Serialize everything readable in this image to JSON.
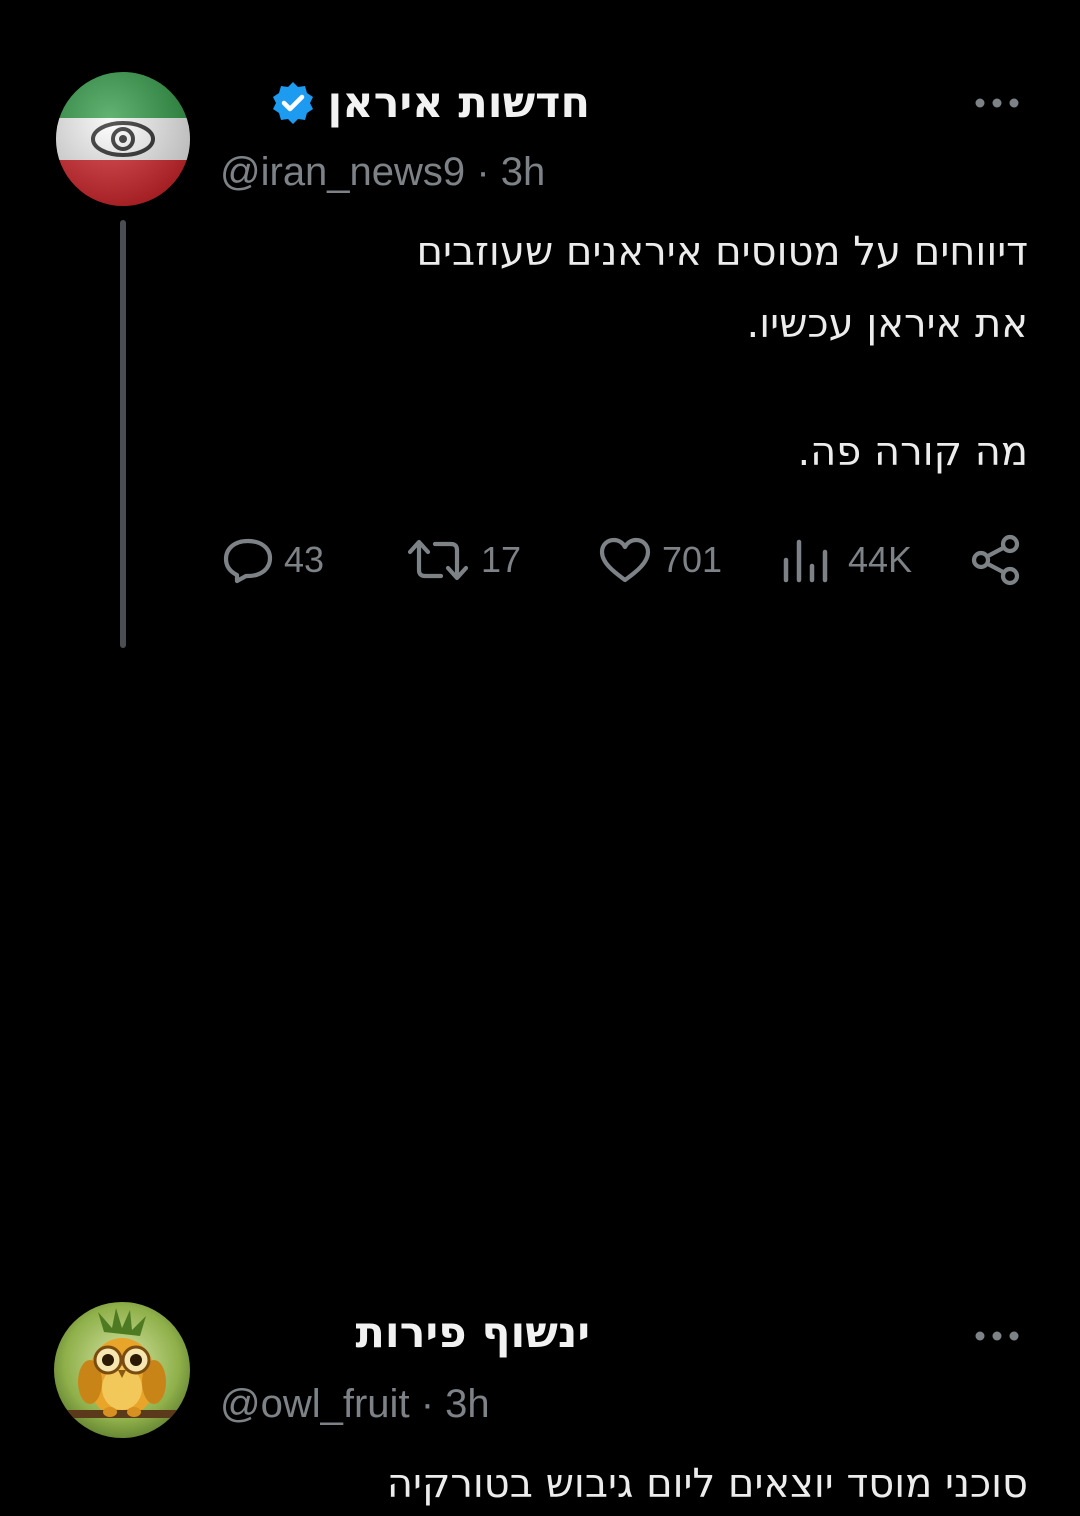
{
  "thread": {
    "original_tweet": {
      "display_name": "חדשות איראן",
      "verified": true,
      "handle": "@iran_news9",
      "separator": "·",
      "time": "3h",
      "text_lines": [
        "דיווחים על מטוסים איראנים שעוזבים",
        "את איראן עכשיו.",
        "מה קורה פה."
      ],
      "avatar_icon": "iran-flag-eye-avatar",
      "actions": {
        "replies": "43",
        "retweets": "17",
        "likes": "701",
        "views": "44K"
      }
    },
    "reply_tweet": {
      "display_name": "ינשוף פירות",
      "handle": "@owl_fruit",
      "separator": "·",
      "time": "3h",
      "text_lines": [
        "סוכני מוסד יוצאים ליום גיבוש בטורקיה"
      ],
      "avatar_icon": "pineapple-owl-avatar"
    }
  },
  "colors": {
    "background": "#000000",
    "text": "#e7e9ea",
    "muted": "#7d8287",
    "verified_badge": "#1d9bf0",
    "thread_line": "#4a4e52"
  }
}
